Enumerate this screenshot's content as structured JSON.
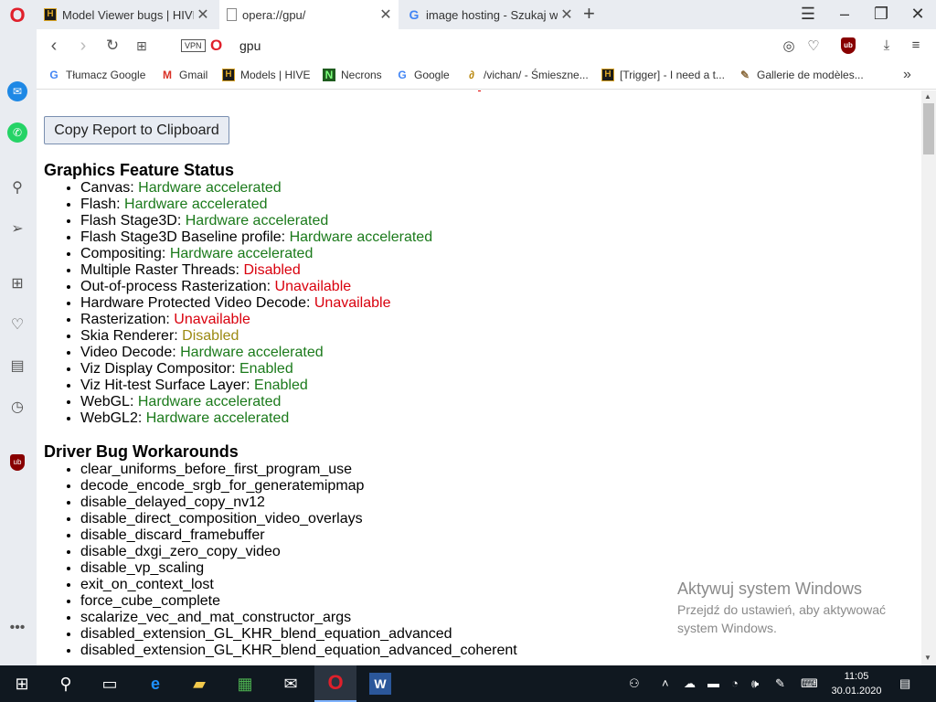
{
  "tabs": [
    {
      "title": "Model Viewer bugs | HIVE",
      "favicon": "hive-icon"
    },
    {
      "title": "opera://gpu/",
      "favicon": "page-icon",
      "active": true
    },
    {
      "title": "image hosting - Szukaj w G",
      "favicon": "google-icon"
    }
  ],
  "address": {
    "url": "gpu",
    "vpn_label": "VPN"
  },
  "bookmarks": [
    {
      "label": "Tłumacz Google",
      "icon": "google-translate-icon"
    },
    {
      "label": "Gmail",
      "icon": "gmail-icon"
    },
    {
      "label": "Models | HIVE",
      "icon": "hive-icon"
    },
    {
      "label": "Necrons",
      "icon": "necrons-icon"
    },
    {
      "label": "Google",
      "icon": "google-icon"
    },
    {
      "label": "/vichan/ - Śmieszne...",
      "icon": "vichan-icon"
    },
    {
      "label": "[Trigger] - I need a t...",
      "icon": "hive-icon"
    },
    {
      "label": "Gallerie de modèles...",
      "icon": "feather-icon"
    }
  ],
  "page": {
    "copy_button": "Copy Report to Clipboard",
    "features_heading": "Graphics Feature Status",
    "features": [
      {
        "name": "Canvas:",
        "status": "Hardware accelerated",
        "tone": "green"
      },
      {
        "name": "Flash:",
        "status": "Hardware accelerated",
        "tone": "green"
      },
      {
        "name": "Flash Stage3D:",
        "status": "Hardware accelerated",
        "tone": "green"
      },
      {
        "name": "Flash Stage3D Baseline profile:",
        "status": "Hardware accelerated",
        "tone": "green"
      },
      {
        "name": "Compositing:",
        "status": "Hardware accelerated",
        "tone": "green"
      },
      {
        "name": "Multiple Raster Threads:",
        "status": "Disabled",
        "tone": "red"
      },
      {
        "name": "Out-of-process Rasterization:",
        "status": "Unavailable",
        "tone": "red"
      },
      {
        "name": "Hardware Protected Video Decode:",
        "status": "Unavailable",
        "tone": "red"
      },
      {
        "name": "Rasterization:",
        "status": "Unavailable",
        "tone": "red"
      },
      {
        "name": "Skia Renderer:",
        "status": "Disabled",
        "tone": "olive"
      },
      {
        "name": "Video Decode:",
        "status": "Hardware accelerated",
        "tone": "green"
      },
      {
        "name": "Viz Display Compositor:",
        "status": "Enabled",
        "tone": "green"
      },
      {
        "name": "Viz Hit-test Surface Layer:",
        "status": "Enabled",
        "tone": "green"
      },
      {
        "name": "WebGL:",
        "status": "Hardware accelerated",
        "tone": "green"
      },
      {
        "name": "WebGL2:",
        "status": "Hardware accelerated",
        "tone": "green"
      }
    ],
    "workarounds_heading": "Driver Bug Workarounds",
    "workarounds": [
      "clear_uniforms_before_first_program_use",
      "decode_encode_srgb_for_generatemipmap",
      "disable_delayed_copy_nv12",
      "disable_direct_composition_video_overlays",
      "disable_discard_framebuffer",
      "disable_dxgi_zero_copy_video",
      "disable_vp_scaling",
      "exit_on_context_lost",
      "force_cube_complete",
      "scalarize_vec_and_mat_constructor_args",
      "disabled_extension_GL_KHR_blend_equation_advanced",
      "disabled_extension_GL_KHR_blend_equation_advanced_coherent"
    ]
  },
  "watermark": {
    "title": "Aktywuj system Windows",
    "subtitle": "Przejdź do ustawień, aby aktywować system Windows."
  },
  "clock": {
    "time": "11:05",
    "date": "30.01.2020"
  },
  "colors": {
    "green": "#1b7a1b",
    "red": "#d9000d",
    "olive": "#9c8a12",
    "opera_red": "#e0202b"
  }
}
